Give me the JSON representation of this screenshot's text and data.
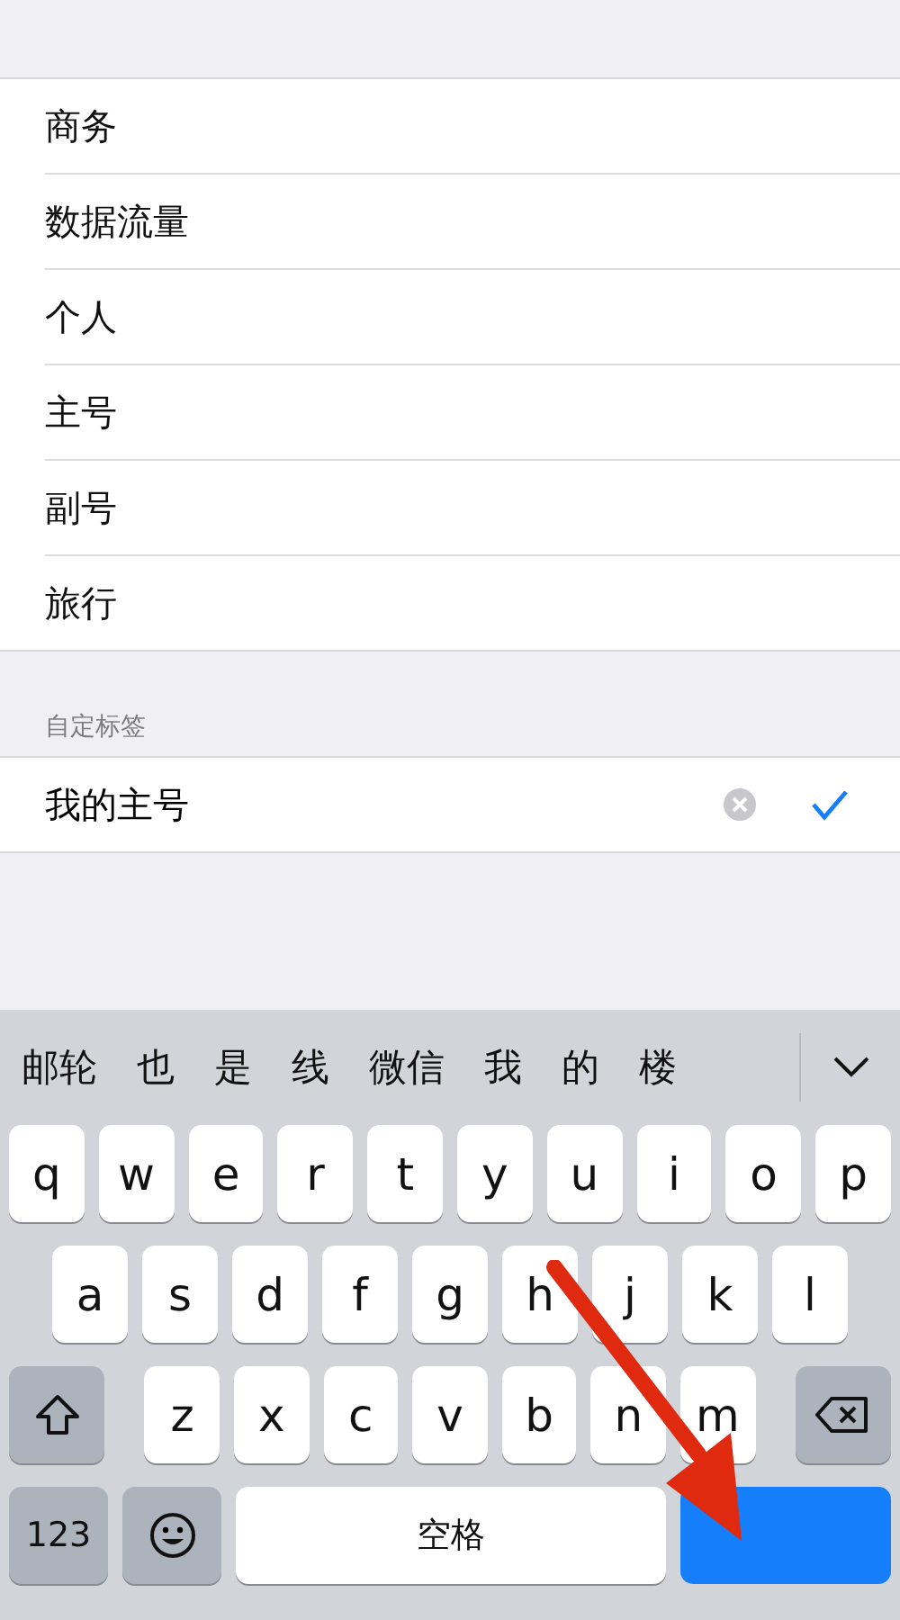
{
  "labels": [
    {
      "text": "商务",
      "selected": false
    },
    {
      "text": "数据流量",
      "selected": false
    },
    {
      "text": "个人",
      "selected": false
    },
    {
      "text": "主号",
      "selected": false
    },
    {
      "text": "副号",
      "selected": false
    },
    {
      "text": "旅行",
      "selected": false
    }
  ],
  "custom_section": {
    "header": "自定标签",
    "value": "我的主号",
    "selected": true
  },
  "keyboard": {
    "candidates": [
      "邮轮",
      "也",
      "是",
      "线",
      "微信",
      "我",
      "的",
      "楼"
    ],
    "rows": [
      [
        "q",
        "w",
        "e",
        "r",
        "t",
        "y",
        "u",
        "i",
        "o",
        "p"
      ],
      [
        "a",
        "s",
        "d",
        "f",
        "g",
        "h",
        "j",
        "k",
        "l"
      ],
      [
        "z",
        "x",
        "c",
        "v",
        "b",
        "n",
        "m"
      ]
    ],
    "numbers_key": "123",
    "space_key": "空格"
  }
}
